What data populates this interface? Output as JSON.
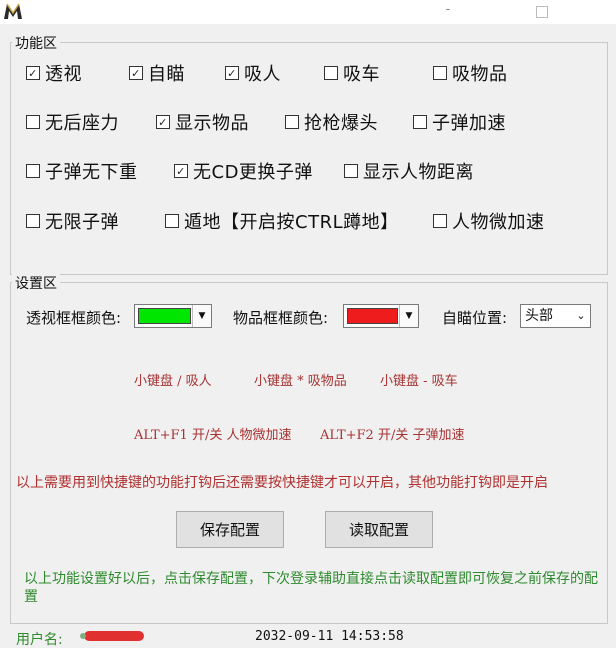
{
  "window": {
    "minimize_glyph": "-"
  },
  "func_group": {
    "title": "功能区",
    "checkboxes": [
      {
        "label": "透视",
        "checked": true
      },
      {
        "label": "自瞄",
        "checked": true
      },
      {
        "label": "吸人",
        "checked": true
      },
      {
        "label": "吸车",
        "checked": false
      },
      {
        "label": "吸物品",
        "checked": false
      },
      {
        "label": "无后座力",
        "checked": false
      },
      {
        "label": "显示物品",
        "checked": true
      },
      {
        "label": "抢枪爆头",
        "checked": false
      },
      {
        "label": "子弹加速",
        "checked": false
      },
      {
        "label": "子弹无下重",
        "checked": false
      },
      {
        "label": "无CD更换子弹",
        "checked": true
      },
      {
        "label": "显示人物距离",
        "checked": false
      },
      {
        "label": "无限子弹",
        "checked": false
      },
      {
        "label": "遁地【开启按CTRL蹲地】",
        "checked": false
      },
      {
        "label": "人物微加速",
        "checked": false
      }
    ]
  },
  "settings_group": {
    "title": "设置区",
    "esp_color_label": "透视框框颜色:",
    "esp_color": "#00e600",
    "item_color_label": "物品框框颜色:",
    "item_color": "#ee1c1c",
    "aim_pos_label": "自瞄位置:",
    "aim_pos_value": "头部",
    "hotkeys_line1": [
      "小键盘 / 吸人",
      "小键盘 * 吸物品",
      "小键盘 - 吸车"
    ],
    "hotkeys_line2": [
      "ALT+F1 开/关 人物微加速",
      "ALT+F2 开/关 子弹加速"
    ],
    "note_red": "以上需要用到快捷键的功能打钩后还需要按快捷键才可以开启，其他功能打钩即是开启",
    "save_button": "保存配置",
    "load_button": "读取配置",
    "note_green": "以上功能设置好以后，点击保存配置，下次登录辅助直接点击读取配置即可恢复之前保存的配置"
  },
  "status": {
    "user_label": "用户名:",
    "datetime": "2032-09-11 14:53:58"
  }
}
